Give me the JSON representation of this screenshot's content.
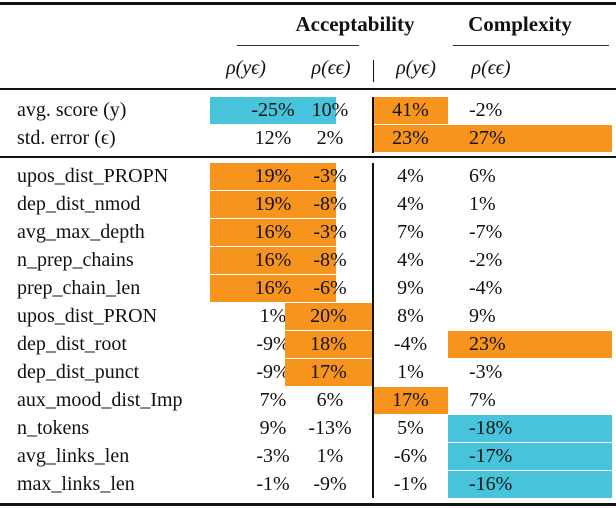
{
  "table": {
    "groups": [
      "Acceptability",
      "Complexity"
    ],
    "columns": [
      "ρ(y_ϵ)",
      "ρ(ϵ_ϵ)",
      "ρ(y_ϵ)",
      "ρ(ϵ_ϵ)"
    ],
    "column_display": [
      "ρ(yϵ)",
      "ρ(ϵϵ)",
      "ρ(yϵ)",
      "ρ(ϵϵ)"
    ],
    "highlight_colors": {
      "positive": "#f7941d",
      "negative": "#47c3dc"
    },
    "section1": [
      {
        "label": "avg. score (y)",
        "values": [
          "-25%",
          "10%",
          "41%",
          "-2%"
        ],
        "highlight": [
          "negative",
          null,
          "positive",
          null
        ]
      },
      {
        "label": "std. error (ϵ)",
        "values": [
          "12%",
          "2%",
          "23%",
          "27%"
        ],
        "highlight": [
          null,
          null,
          "positive",
          "positive"
        ]
      }
    ],
    "section2": [
      {
        "label": "upos_dist_PROPN",
        "values": [
          "19%",
          "-3%",
          "4%",
          "6%"
        ],
        "highlight": [
          "positive",
          null,
          null,
          null
        ]
      },
      {
        "label": "dep_dist_nmod",
        "values": [
          "19%",
          "-8%",
          "4%",
          "1%"
        ],
        "highlight": [
          "positive",
          null,
          null,
          null
        ]
      },
      {
        "label": "avg_max_depth",
        "values": [
          "16%",
          "-3%",
          "7%",
          "-7%"
        ],
        "highlight": [
          "positive",
          null,
          null,
          null
        ]
      },
      {
        "label": "n_prep_chains",
        "values": [
          "16%",
          "-8%",
          "4%",
          "-2%"
        ],
        "highlight": [
          "positive",
          null,
          null,
          null
        ]
      },
      {
        "label": "prep_chain_len",
        "values": [
          "16%",
          "-6%",
          "9%",
          "-4%"
        ],
        "highlight": [
          "positive",
          null,
          null,
          null
        ]
      },
      {
        "label": "upos_dist_PRON",
        "values": [
          "1%",
          "20%",
          "8%",
          "9%"
        ],
        "highlight": [
          null,
          "positive",
          null,
          null
        ]
      },
      {
        "label": "dep_dist_root",
        "values": [
          "-9%",
          "18%",
          "-4%",
          "23%"
        ],
        "highlight": [
          null,
          "positive",
          null,
          "positive"
        ]
      },
      {
        "label": "dep_dist_punct",
        "values": [
          "-9%",
          "17%",
          "1%",
          "-3%"
        ],
        "highlight": [
          null,
          "positive",
          null,
          null
        ]
      },
      {
        "label": "aux_mood_dist_Imp",
        "values": [
          "7%",
          "6%",
          "17%",
          "7%"
        ],
        "highlight": [
          null,
          null,
          "positive",
          null
        ]
      },
      {
        "label": "n_tokens",
        "values": [
          "9%",
          "-13%",
          "5%",
          "-18%"
        ],
        "highlight": [
          null,
          null,
          null,
          "negative"
        ]
      },
      {
        "label": "avg_links_len",
        "values": [
          "-3%",
          "1%",
          "-6%",
          "-17%"
        ],
        "highlight": [
          null,
          null,
          null,
          "negative"
        ]
      },
      {
        "label": "max_links_len",
        "values": [
          "-1%",
          "-9%",
          "-1%",
          "-16%"
        ],
        "highlight": [
          null,
          null,
          null,
          "negative"
        ]
      }
    ]
  }
}
